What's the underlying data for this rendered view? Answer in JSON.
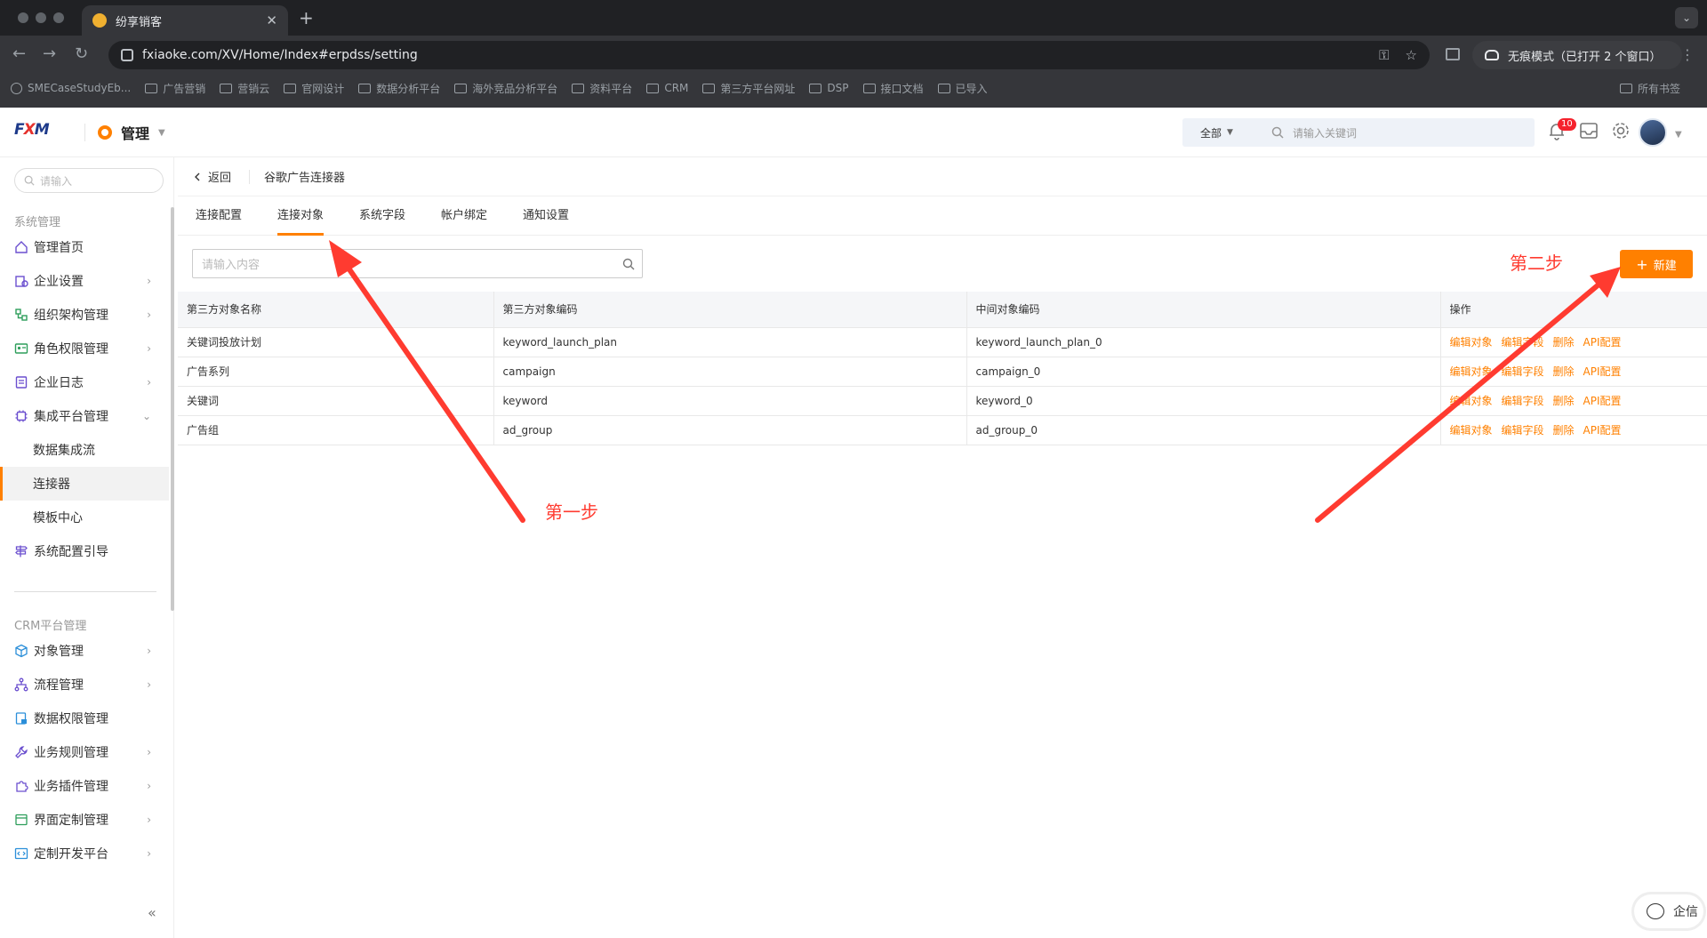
{
  "browser": {
    "tab_title": "纷享销客",
    "url": "fxiaoke.com/XV/Home/Index#erpdss/setting",
    "incognito_label": "无痕模式（已打开 2 个窗口）",
    "bookmarks": [
      "SMECaseStudyEb...",
      "广告营销",
      "营销云",
      "官网设计",
      "数据分析平台",
      "海外竞品分析平台",
      "资料平台",
      "CRM",
      "第三方平台网址",
      "DSP",
      "接口文档",
      "已导入"
    ],
    "all_bookmarks": "所有书签"
  },
  "topbar": {
    "app_label": "管理",
    "search_scope": "全部",
    "search_placeholder": "请输入关键词",
    "notification_count": "10"
  },
  "sidebar": {
    "search_placeholder": "请输入",
    "group1": "系统管理",
    "items1": [
      "管理首页",
      "企业设置",
      "组织架构管理",
      "角色权限管理",
      "企业日志",
      "集成平台管理",
      "数据集成流",
      "连接器",
      "模板中心",
      "系统配置引导"
    ],
    "group2": "CRM平台管理",
    "items2": [
      "对象管理",
      "流程管理",
      "数据权限管理",
      "业务规则管理",
      "业务插件管理",
      "界面定制管理",
      "定制开发平台"
    ]
  },
  "main": {
    "back_label": "返回",
    "breadcrumb_title": "谷歌广告连接器",
    "tabs": [
      "连接配置",
      "连接对象",
      "系统字段",
      "帐户绑定",
      "通知设置"
    ],
    "filter_placeholder": "请输入内容",
    "new_button": "新建",
    "annotation_step1": "第一步",
    "annotation_step2": "第二步",
    "table": {
      "headers": [
        "第三方对象名称",
        "第三方对象编码",
        "中间对象编码",
        "操作"
      ],
      "rows": [
        [
          "关键词投放计划",
          "keyword_launch_plan",
          "keyword_launch_plan_0"
        ],
        [
          "广告系列",
          "campaign",
          "campaign_0"
        ],
        [
          "关键词",
          "keyword",
          "keyword_0"
        ],
        [
          "广告组",
          "ad_group",
          "ad_group_0"
        ]
      ],
      "actions": [
        "编辑对象",
        "编辑字段",
        "删除",
        "API配置"
      ]
    }
  },
  "chat_widget": "企信",
  "colors": {
    "accent": "#ff8000",
    "annotation": "#ff3b30"
  }
}
